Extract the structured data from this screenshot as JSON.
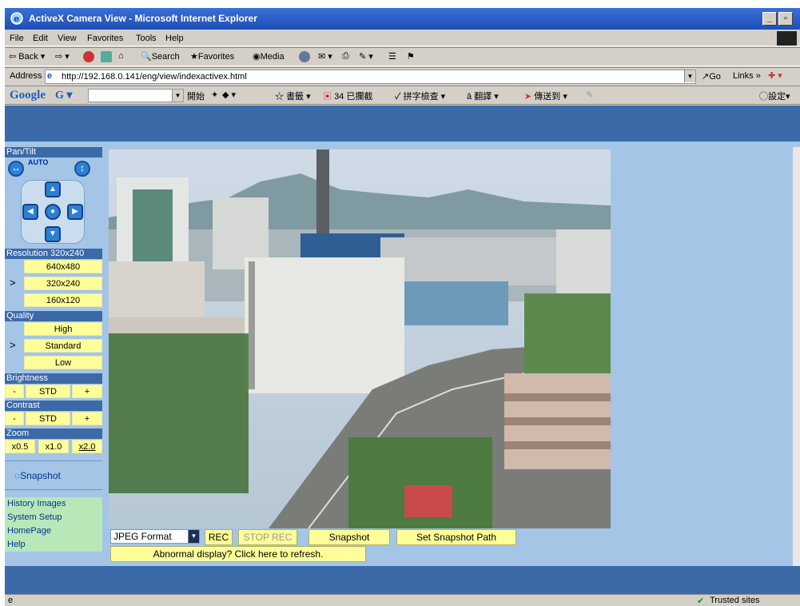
{
  "window": {
    "title": "ActiveX Camera View - Microsoft Internet Explorer"
  },
  "menu": [
    "File",
    "Edit",
    "View",
    "Favorites",
    "Tools",
    "Help"
  ],
  "toolbar": {
    "back": "Back",
    "search": "Search",
    "favorites": "Favorites",
    "media": "Media"
  },
  "address": {
    "label": "Address",
    "url": "http://192.168.0.141/eng/view/indexactivex.html",
    "go": "Go",
    "links": "Links"
  },
  "google_bar": {
    "brand": "Google",
    "start": "開始",
    "bookmarks": "書籤",
    "blocked": "34 已攔截",
    "spellcheck": "拼字檢查",
    "translate": "翻譯",
    "sendto": "傳送到",
    "settings": "設定"
  },
  "sidebar": {
    "pantilt_label": "Pan/Tilt",
    "auto_label": "AUTO",
    "resolution_header": "Resolution 320x240",
    "resolution_options": [
      "640x480",
      "320x240",
      "160x120"
    ],
    "resolution_selected_marker": ">",
    "quality_header": "Quality",
    "quality_options": [
      "High",
      "Standard",
      "Low"
    ],
    "quality_selected_marker": ">",
    "brightness_header": "Brightness",
    "brightness_minus": "-",
    "brightness_std": "STD",
    "brightness_plus": "+",
    "contrast_header": "Contrast",
    "contrast_minus": "-",
    "contrast_std": "STD",
    "contrast_plus": "+",
    "zoom_header": "Zoom",
    "zoom_options": [
      "x0.5",
      "x1.0",
      "x2.0"
    ],
    "snapshot_label": "Snapshot",
    "links": [
      "History Images",
      "System Setup",
      "HomePage",
      "Help"
    ]
  },
  "controls": {
    "format_selected": "JPEG Format",
    "rec": "REC",
    "stop_rec": "STOP REC",
    "snapshot": "Snapshot",
    "set_snapshot_path": "Set Snapshot Path",
    "refresh": "Abnormal display? Click here to refresh."
  },
  "status": {
    "zone": "Trusted sites"
  }
}
